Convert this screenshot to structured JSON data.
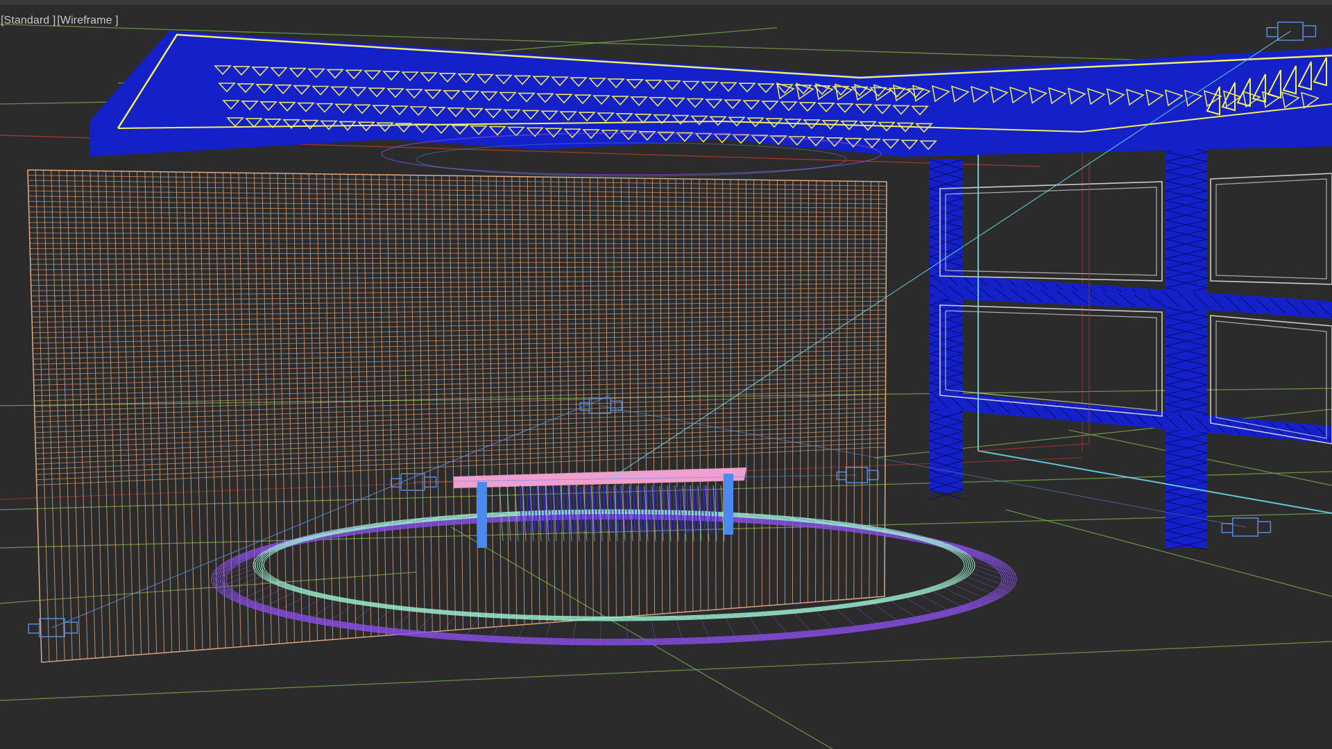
{
  "viewport": {
    "menu_label_1": "[Standard ]",
    "menu_label_2": "[Wireframe ]"
  },
  "colors": {
    "background": "#2b2b2b",
    "grid_green": "#7aa84a",
    "grid_red": "#b53b2e",
    "truss_blue": "#1420c8",
    "truss_yellow": "#f5f060",
    "wall_orange": "#e8b08a",
    "ring_purple": "#8a4fe8",
    "ring_cyan": "#9bf0d0",
    "desk_pink": "#f0a0d0",
    "desk_blue": "#4a8af0",
    "camera_blue": "#5b8ad8",
    "frame_white": "#e8e8e8",
    "cyan_line": "#6ad8e8"
  },
  "scene_objects": [
    "overhead-truss",
    "led-wall-mesh",
    "floor-ring",
    "news-desk",
    "side-truss-frames",
    "camera-left",
    "camera-center",
    "camera-right",
    "camera-top-right",
    "camera-bottom-right"
  ]
}
